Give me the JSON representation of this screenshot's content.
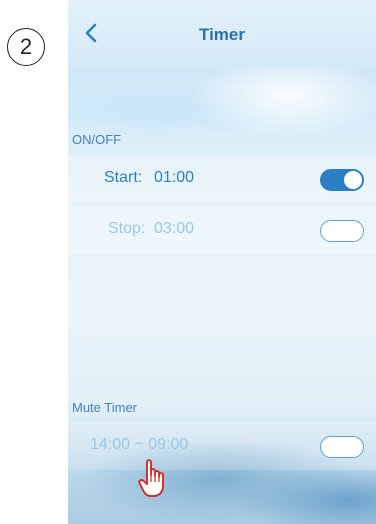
{
  "step": {
    "number": "2"
  },
  "header": {
    "title": "Timer"
  },
  "onoff": {
    "section_label": "ON/OFF",
    "start": {
      "label": "Start:",
      "time": "01:00",
      "enabled": true
    },
    "stop": {
      "label": "Stop:",
      "time": "03:00",
      "enabled": false
    }
  },
  "mute": {
    "section_label": "Mute Timer",
    "range": "14:00 ~ 09:00",
    "enabled": false
  },
  "icons": {
    "back": "chevron-left-icon",
    "pointer": "hand-pointer-icon"
  },
  "colors": {
    "accent": "#2b80c5",
    "title": "#2c6fb0",
    "disabled_text": "#9ac7e6"
  }
}
